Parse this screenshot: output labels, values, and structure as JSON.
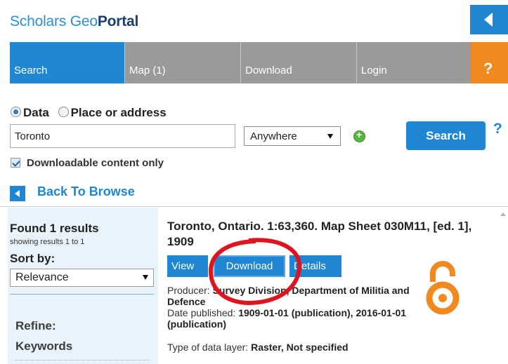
{
  "header": {
    "logo_part1": "Scholars Geo",
    "logo_part2": "Portal"
  },
  "nav": {
    "tabs": [
      "Search",
      "Map (1)",
      "Download",
      "Login"
    ],
    "help": "?"
  },
  "search": {
    "radio_data": "Data",
    "radio_place": "Place or address",
    "query": "Toronto",
    "scope": "Anywhere",
    "button": "Search",
    "help": "?",
    "downloadable_label": "Downloadable content only"
  },
  "back_label": "Back To Browse",
  "sidebar": {
    "found": "Found 1 results",
    "showing": "showing results 1 to 1",
    "sort_label": "Sort by:",
    "sort_value": "Relevance",
    "refine": "Refine:",
    "keywords": "Keywords"
  },
  "result": {
    "title": "Toronto, Ontario. 1:63,360. Map Sheet 030M11, [ed. 1], 1909",
    "buttons": {
      "view": "View",
      "download": "Download",
      "details": "Details"
    },
    "producer_label": "Producer: ",
    "producer_value": "Survey Division, Department of Militia and Defence",
    "date_label": "Date published: ",
    "date_value": "1909-01-01 (publication), 2016-01-01 (publication)",
    "type_label": "Type of data layer: ",
    "type_value": "Raster, Not specified"
  },
  "colors": {
    "primary": "#1f86d4",
    "tab_inactive": "#9a9a9a",
    "help_orange": "#f08a1f",
    "open_access": "#f08a1f",
    "annotation": "#e0141e"
  }
}
